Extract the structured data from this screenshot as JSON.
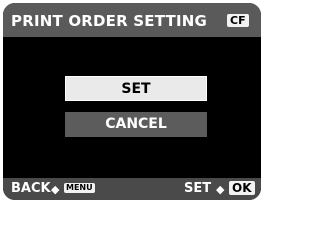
{
  "title_bar": {
    "title": "PRINT ORDER SETTING",
    "card_label": "CF"
  },
  "menu": {
    "items": [
      {
        "label": "SET",
        "selected": true
      },
      {
        "label": "CANCEL",
        "selected": false
      }
    ]
  },
  "bottom_bar": {
    "back_label": "BACK",
    "back_key": "MENU",
    "set_label": "SET",
    "ok_key": "OK",
    "arrow_icon": "arrow-right-icon"
  },
  "colors": {
    "screen_bg": "#000000",
    "title_bar_bg": "#5a5a5a",
    "selected_item_bg": "#eaeaea",
    "unselected_item_bg": "#5c5c5c",
    "bottom_bar_bg": "#4a4a4a"
  }
}
